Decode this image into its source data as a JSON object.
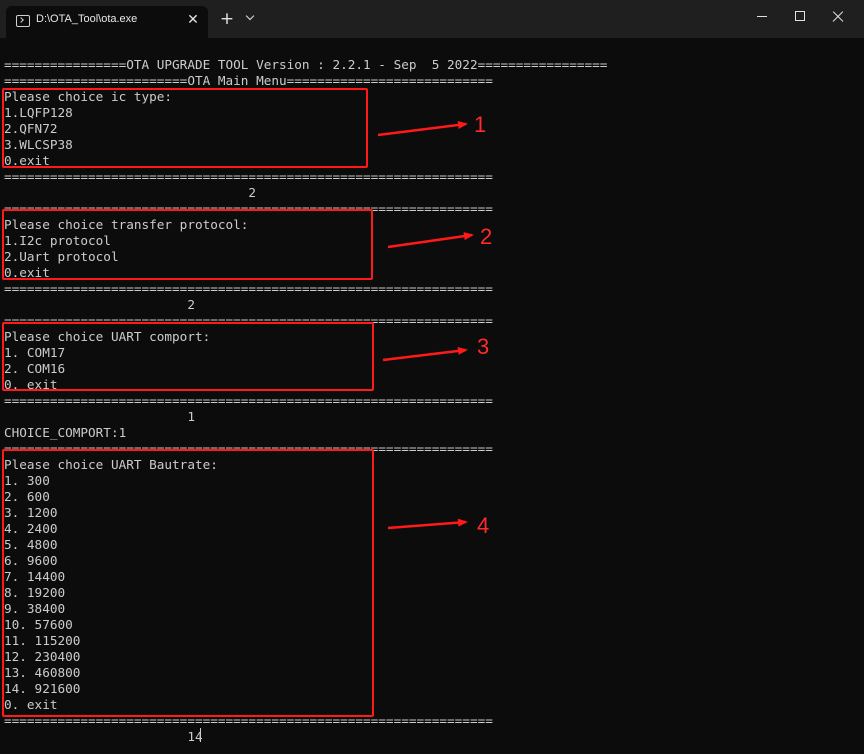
{
  "window": {
    "tab_title": "D:\\OTA_Tool\\ota.exe",
    "tab_close_glyph": "✕",
    "new_tab_glyph": "+"
  },
  "terminal": {
    "lines": [
      "================OTA UPGRADE TOOL Version : 2.2.1 - Sep  5 2022=================",
      "========================OTA Main Menu===========================",
      "Please choice ic type:",
      "1.LQFP128",
      "2.QFN72",
      "3.WLCSP38",
      "0.exit",
      "================================================================",
      "                                2",
      "================================================================",
      "Please choice transfer protocol:",
      "1.I2c protocol",
      "2.Uart protocol",
      "0.exit",
      "================================================================",
      "                        2",
      "================================================================",
      "Please choice UART comport:",
      "1. COM17",
      "2. COM16",
      "0. exit",
      "================================================================",
      "                        1",
      "CHOICE_COMPORT:1",
      "================================================================",
      "Please choice UART Bautrate:",
      "1. 300",
      "2. 600",
      "3. 1200",
      "4. 2400",
      "5. 4800",
      "6. 9600",
      "7. 14400",
      "8. 19200",
      "9. 38400",
      "10. 57600",
      "11. 115200",
      "12. 230400",
      "13. 460800",
      "14. 921600",
      "0. exit",
      "================================================================",
      "                        14"
    ]
  },
  "annotations": {
    "color": "#ff1a1a",
    "labels": [
      "1",
      "2",
      "3",
      "4"
    ]
  }
}
